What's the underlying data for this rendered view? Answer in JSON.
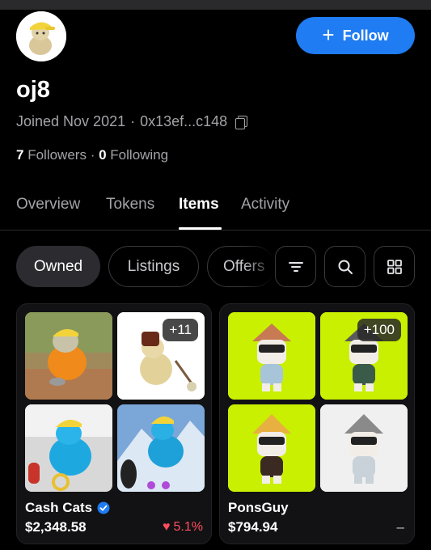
{
  "profile": {
    "username": "oj8",
    "joined": "Joined Nov 2021",
    "separator": "·",
    "address": "0x13ef...c148",
    "followers_count": "7",
    "followers_label": "Followers",
    "following_count": "0",
    "following_label": "Following",
    "dot": "·",
    "avatar_icon": "cat-with-cap-avatar"
  },
  "follow_button": {
    "label": "Follow",
    "icon": "plus-icon"
  },
  "tabs": [
    {
      "label": "Overview",
      "active": false
    },
    {
      "label": "Tokens",
      "active": false
    },
    {
      "label": "Items",
      "active": true
    },
    {
      "label": "Activity",
      "active": false
    }
  ],
  "filters": {
    "chips": [
      {
        "label": "Owned",
        "active": true
      },
      {
        "label": "Listings",
        "active": false
      },
      {
        "label": "Offers",
        "active": false
      }
    ],
    "icons": [
      "filter-icon",
      "search-icon",
      "grid-view-icon"
    ]
  },
  "collections": [
    {
      "name": "Cash Cats",
      "verified": true,
      "price": "$2,348.58",
      "change": "5.1%",
      "change_direction": "down",
      "extra_count": "+11"
    },
    {
      "name": "PonsGuy",
      "verified": false,
      "price": "$794.94",
      "change": "–",
      "extra_count": "+100"
    }
  ],
  "colors": {
    "accent": "#1f7cf2",
    "negative": "#ff4d5e",
    "lime": "#c8f000"
  }
}
